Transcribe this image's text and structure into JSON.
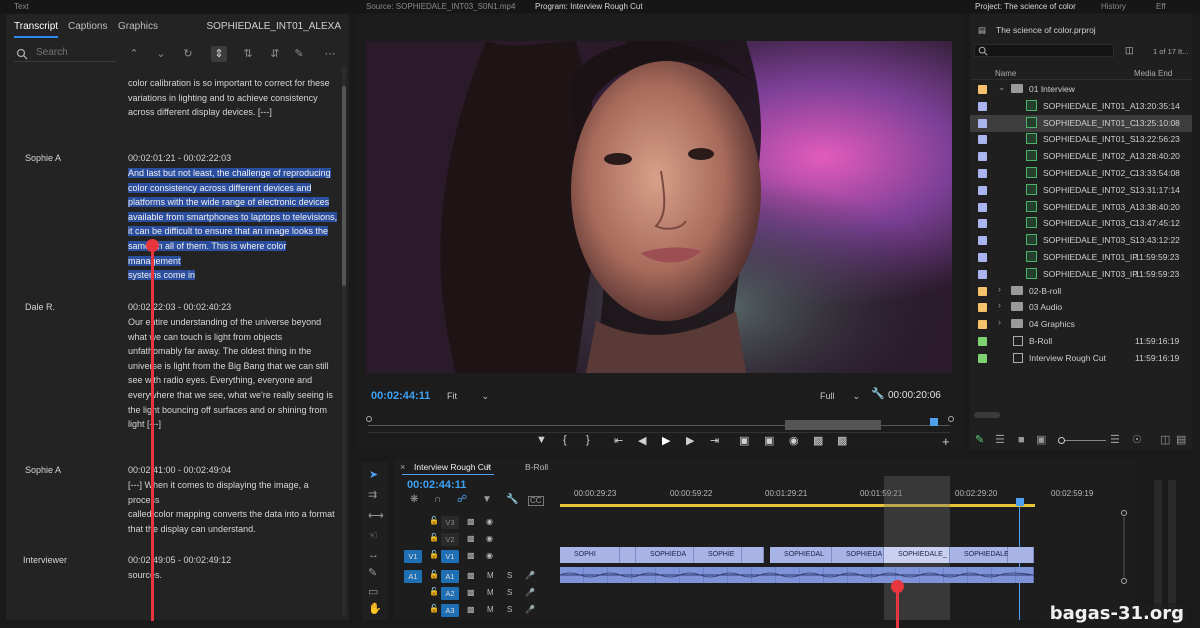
{
  "topbar": {
    "left_label": "Text",
    "source_label": "Source: SOPHIEDALE_INT03_S0N1.mp4",
    "program_label": "Program: Interview Rough Cut",
    "project_label": "Project: The science of color",
    "history_label": "History",
    "extra_label": "Eff"
  },
  "transcript": {
    "tabs": [
      "Transcript",
      "Captions",
      "Graphics"
    ],
    "clip_title": "SOPHIEDALE_INT01_ALEXA",
    "search_placeholder": "Search",
    "entries": [
      {
        "speaker": "",
        "timecode": "",
        "lines": [
          "color calibration is so important to correct for these",
          "variations in lighting and to achieve consistency",
          "across different display devices. [---]"
        ]
      },
      {
        "speaker": "Sophie A",
        "timecode": "00:02:01:21 - 00:02:22:03",
        "lines": [
          "And last but not least, the challenge of reproducing",
          "color consistency across different devices and",
          "platforms with the wide range of electronic devices",
          "available from smartphones to laptops to televisions,",
          "it can be difficult to ensure that an image looks the",
          "same on all of them. This is where color management",
          "systems come in"
        ]
      },
      {
        "speaker": "Dale R.",
        "timecode": "00:02:22:03 - 00:02:40:23",
        "lines": [
          "Our entire understanding of the universe beyond",
          "what we can touch is light from objects",
          "unfathomably far away. The oldest thing in the",
          "universe is light from the Big Bang that we can still",
          "see with radio eyes. Everything, everyone and",
          "everywhere that we see, what we're really seeing is",
          "the light bouncing off surfaces and or shining from",
          "light [---]"
        ]
      },
      {
        "speaker": "Sophie A",
        "timecode": "00:02:41:00 - 00:02:49:04",
        "lines": [
          "[---] When it comes to displaying the image, a process",
          "called color mapping converts the data into a format",
          "that the display can understand."
        ]
      },
      {
        "speaker": "Interviewer",
        "timecode": "00:02:49:05 - 00:02:49:12",
        "lines": [
          "sources."
        ]
      }
    ]
  },
  "monitor": {
    "timecode_left": "00:02:44:11",
    "fit_option": "Fit",
    "full_option": "Full",
    "timecode_right": "00:00:20:06"
  },
  "project": {
    "file_name": "The science of color.prproj",
    "count_label": "1 of 17 It...",
    "col_name": "Name",
    "col_media_end": "Media End",
    "rows": [
      {
        "kind": "folder-open",
        "name": "01 Interview",
        "media_end": "",
        "color": "#f5c26b",
        "indent": 0
      },
      {
        "kind": "clip",
        "name": "SOPHIEDALE_INT01_A",
        "media_end": "13:20:35:14",
        "color": "#aab4ee",
        "indent": 1
      },
      {
        "kind": "clip",
        "name": "SOPHIEDALE_INT01_C",
        "media_end": "13:25:10:08",
        "color": "#aab4ee",
        "indent": 1,
        "selected": true
      },
      {
        "kind": "clip",
        "name": "SOPHIEDALE_INT01_S",
        "media_end": "13:22:56:23",
        "color": "#aab4ee",
        "indent": 1
      },
      {
        "kind": "clip",
        "name": "SOPHIEDALE_INT02_A",
        "media_end": "13:28:40:20",
        "color": "#aab4ee",
        "indent": 1
      },
      {
        "kind": "clip",
        "name": "SOPHIEDALE_INT02_C",
        "media_end": "13:33:54:08",
        "color": "#aab4ee",
        "indent": 1
      },
      {
        "kind": "clip",
        "name": "SOPHIEDALE_INT02_S",
        "media_end": "13:31:17:14",
        "color": "#aab4ee",
        "indent": 1
      },
      {
        "kind": "clip",
        "name": "SOPHIEDALE_INT03_A",
        "media_end": "13:38:40:20",
        "color": "#aab4ee",
        "indent": 1
      },
      {
        "kind": "clip",
        "name": "SOPHIEDALE_INT03_C",
        "media_end": "13:47:45:12",
        "color": "#aab4ee",
        "indent": 1
      },
      {
        "kind": "clip",
        "name": "SOPHIEDALE_INT03_S",
        "media_end": "13:43:12:22",
        "color": "#aab4ee",
        "indent": 1
      },
      {
        "kind": "clip",
        "name": "SOPHIEDALE_INT01_IP",
        "media_end": "11:59:59:23",
        "color": "#aab4ee",
        "indent": 1
      },
      {
        "kind": "clip",
        "name": "SOPHIEDALE_INT03_IP",
        "media_end": "11:59:59:23",
        "color": "#aab4ee",
        "indent": 1
      },
      {
        "kind": "folder",
        "name": "02-B-roll",
        "media_end": "",
        "color": "#f5c26b",
        "indent": 0
      },
      {
        "kind": "folder",
        "name": "03 Audio",
        "media_end": "",
        "color": "#f5c26b",
        "indent": 0
      },
      {
        "kind": "folder",
        "name": "04 Graphics",
        "media_end": "",
        "color": "#f5c26b",
        "indent": 0
      },
      {
        "kind": "sequence",
        "name": "B-Roll",
        "media_end": "11:59:16:19",
        "color": "#7cd36f",
        "indent": 0
      },
      {
        "kind": "sequence",
        "name": "Interview Rough Cut",
        "media_end": "11:59:16:19",
        "color": "#7cd36f",
        "indent": 0
      }
    ]
  },
  "timeline": {
    "tabs": [
      "Interview Rough Cut",
      "B-Roll"
    ],
    "timecode": "00:02:44:11",
    "ruler": [
      "00:00:29:23",
      "00:00:59:22",
      "00:01:29:21",
      "00:01:59:21",
      "00:02:29:20",
      "00:02:59:19"
    ],
    "video_tracks": [
      {
        "src": "",
        "name": "V3"
      },
      {
        "src": "",
        "name": "V2"
      },
      {
        "src": "V1",
        "name": "V1"
      }
    ],
    "audio_tracks": [
      {
        "src": "A1",
        "name": "A1"
      },
      {
        "src": "",
        "name": "A2"
      },
      {
        "src": "",
        "name": "A3"
      }
    ],
    "v1_clips": [
      "SOPHI",
      "SOPHIEDA",
      "SOPHIE",
      "SOPHIEDAL",
      "SOPHIEDA",
      "SOPHIEDALE_",
      "SOPHIEDALE"
    ]
  },
  "watermark": "bagas-31.org"
}
